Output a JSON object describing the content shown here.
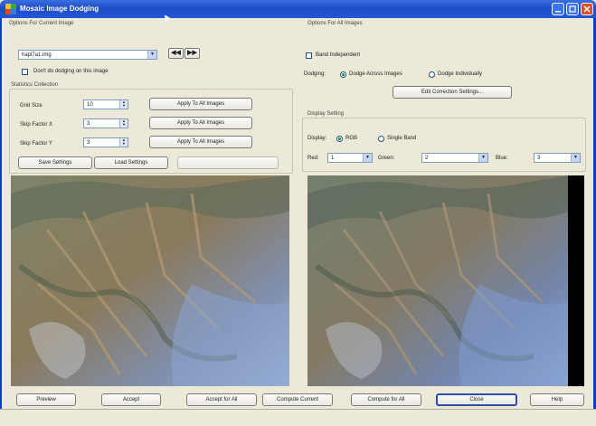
{
  "window": {
    "title": "Mosaic Image Dodging",
    "app_icon": "mosaic-app-icon",
    "controls": [
      "minimize-icon",
      "maximize-icon",
      "close-icon"
    ]
  },
  "current_image": {
    "group_label": "Options For Current Image",
    "image_select": {
      "value": "hapl7a1.img"
    },
    "prev_label": "◀◀",
    "next_label": "▶▶",
    "dont_dodge_label": "Don't do dodging on this image",
    "dont_dodge_checked": false
  },
  "stats": {
    "group_label": "Statistics Collection",
    "rows": [
      {
        "label": "Grid Size",
        "value": "10",
        "button": "Apply To All Images"
      },
      {
        "label": "Skip Factor X",
        "value": "3",
        "button": "Apply To All Images"
      },
      {
        "label": "Skip Factor Y",
        "value": "3",
        "button": "Apply To All Images"
      }
    ],
    "save_label": "Save Settings",
    "load_label": "Load Settings",
    "extra_label": ""
  },
  "all_images": {
    "group_label": "Options For All Images",
    "band_independent_label": "Band Independent",
    "band_independent_checked": false,
    "dodging_label": "Dodging:",
    "dodge_across_label": "Dodge Across Images",
    "dodge_individually_label": "Dodge Individually",
    "dodge_mode": "across",
    "edit_correction_label": "Edit Correction Settings..."
  },
  "display": {
    "group_label": "Display Setting",
    "display_label": "Display:",
    "rgb_label": "RGB",
    "single_band_label": "Single Band",
    "mode": "rgb",
    "red_label": "Red:",
    "red_value": "1",
    "green_label": "Green:",
    "green_value": "2",
    "blue_label": "Blue:",
    "blue_value": "3"
  },
  "viewers": {
    "left_image": "original-satellite-image",
    "right_image": "dodged-satellite-image"
  },
  "bottom": {
    "preview": "Preview",
    "accept": "Accept",
    "accept_all": "Accept for All",
    "compute_current": "Compute Current",
    "compute_all": "Compute for All",
    "close": "Close",
    "help": "Help"
  },
  "colors": {
    "titlebar": "#1e4cc7",
    "dialog_bg": "#ece9d8",
    "viewer_bg": "#000000"
  }
}
